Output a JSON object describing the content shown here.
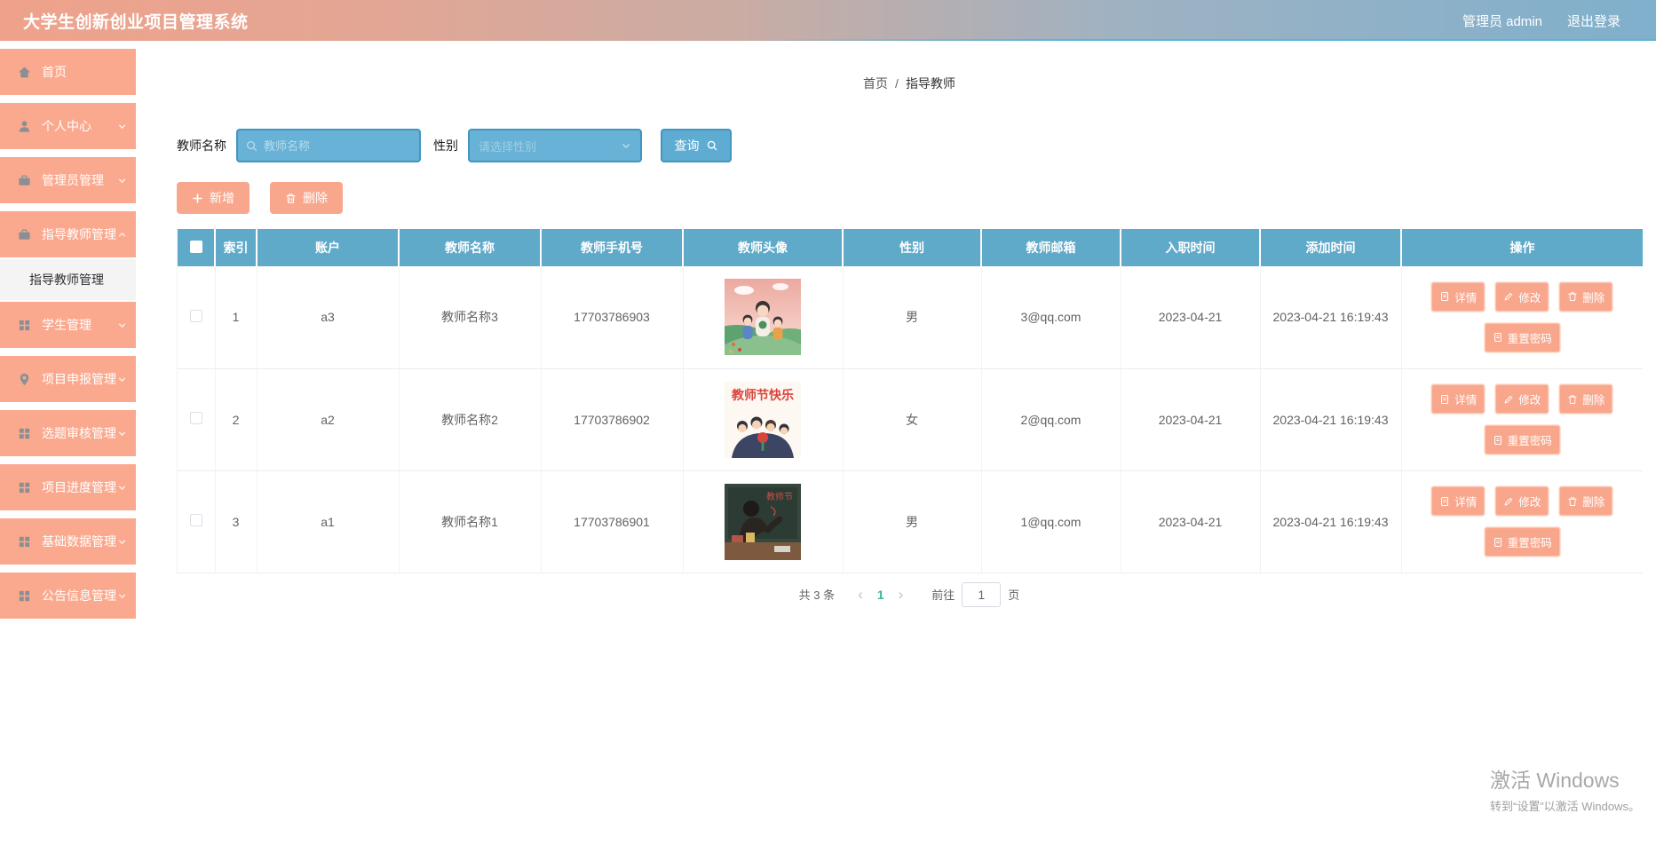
{
  "header": {
    "title": "大学生创新创业项目管理系统",
    "admin_label": "管理员 admin",
    "logout_label": "退出登录"
  },
  "sidebar": {
    "items": [
      {
        "label": "首页",
        "icon": "home-icon"
      },
      {
        "label": "个人中心",
        "icon": "user-icon"
      },
      {
        "label": "管理员管理",
        "icon": "briefcase-icon"
      },
      {
        "label": "指导教师管理",
        "icon": "briefcase-icon",
        "expanded": true,
        "children": [
          {
            "label": "指导教师管理",
            "active": true
          }
        ]
      },
      {
        "label": "学生管理",
        "icon": "grid-icon"
      },
      {
        "label": "项目申报管理",
        "icon": "map-pin-icon"
      },
      {
        "label": "选题审核管理",
        "icon": "grid-icon"
      },
      {
        "label": "项目进度管理",
        "icon": "grid-icon"
      },
      {
        "label": "基础数据管理",
        "icon": "grid-icon"
      },
      {
        "label": "公告信息管理",
        "icon": "grid-icon"
      }
    ]
  },
  "breadcrumb": {
    "home": "首页",
    "separator": "/",
    "current": "指导教师"
  },
  "filters": {
    "name_label": "教师名称",
    "name_placeholder": "教师名称",
    "gender_label": "性别",
    "gender_placeholder": "请选择性别",
    "query_label": "查询"
  },
  "toolbar": {
    "add_label": "新增",
    "delete_label": "删除"
  },
  "table": {
    "columns": [
      "索引",
      "账户",
      "教师名称",
      "教师手机号",
      "教师头像",
      "性别",
      "教师邮箱",
      "入职时间",
      "添加时间",
      "操作"
    ],
    "rows": [
      {
        "index": "1",
        "account": "a3",
        "name": "教师名称3",
        "phone": "17703786903",
        "avatar": "teacher-with-children-illustration",
        "gender": "男",
        "email": "3@qq.com",
        "join_date": "2023-04-21",
        "add_time": "2023-04-21 16:19:43"
      },
      {
        "index": "2",
        "account": "a2",
        "name": "教师名称2",
        "phone": "17703786902",
        "avatar": "teachers-day-poster",
        "gender": "女",
        "email": "2@qq.com",
        "join_date": "2023-04-21",
        "add_time": "2023-04-21 16:19:43"
      },
      {
        "index": "3",
        "account": "a1",
        "name": "教师名称1",
        "phone": "17703786901",
        "avatar": "teacher-at-blackboard",
        "gender": "男",
        "email": "1@qq.com",
        "join_date": "2023-04-21",
        "add_time": "2023-04-21 16:19:43"
      }
    ]
  },
  "avatar_texts": {
    "poster": "教师节快乐",
    "blackboard": "教师节"
  },
  "row_actions": {
    "detail": "详情",
    "edit": "修改",
    "delete": "删除",
    "reset_password": "重置密码"
  },
  "pagination": {
    "total_label": "共 3 条",
    "prev": "‹",
    "current_page": "1",
    "next": "›",
    "goto_label": "前往",
    "goto_value": "1",
    "page_label": "页"
  },
  "watermark": {
    "line1": "激活 Windows",
    "line2": "转到“设置”以激活 Windows。"
  },
  "icons": {
    "search-icon": "magnifier",
    "plus-icon": "plus",
    "trash-icon": "trash",
    "document-icon": "document",
    "pencil-icon": "pencil",
    "home-icon": "house",
    "user-icon": "person",
    "briefcase-icon": "briefcase",
    "grid-icon": "grid-of-squares",
    "map-pin-icon": "map-pin",
    "chevron-down-icon": "chevron-down",
    "chevron-up-icon": "chevron-up"
  },
  "colors": {
    "sidebar_salmon": "#fba98e",
    "button_salmon": "#f9a78c",
    "header_gradient_left": "#efa28b",
    "header_gradient_right": "#7fb0cc",
    "table_header_blue": "#5fa9c9",
    "field_blue": "#67b2d6",
    "field_border_blue": "#4195c0",
    "active_page_teal": "#3cb59b"
  }
}
